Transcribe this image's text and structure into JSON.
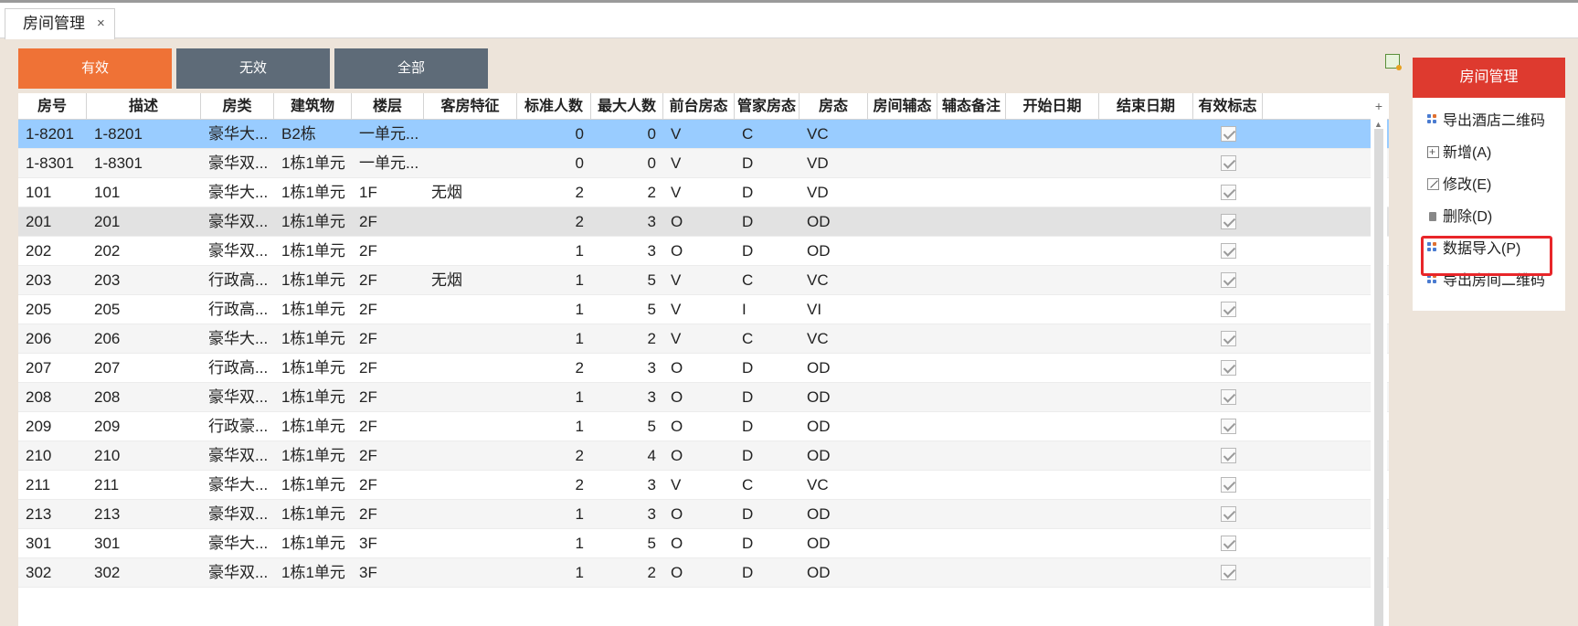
{
  "tab": {
    "label": "房间管理",
    "close": "×"
  },
  "filters": {
    "valid": "有效",
    "invalid": "无效",
    "all": "全部"
  },
  "columns": [
    "房号",
    "描述",
    "房类",
    "建筑物",
    "楼层",
    "客房特征",
    "标准人数",
    "最大人数",
    "前台房态",
    "管家房态",
    "房态",
    "房间辅态",
    "辅态备注",
    "开始日期",
    "结束日期",
    "有效标志"
  ],
  "rows": [
    {
      "no": "1-8201",
      "desc": "1-8201",
      "type": "豪华大...",
      "bldg": "B2栋",
      "floor": "一单元...",
      "feat": "",
      "std": "0",
      "max": "0",
      "fd": "V",
      "hk": "C",
      "st": "VC",
      "valid": true
    },
    {
      "no": "1-8301",
      "desc": "1-8301",
      "type": "豪华双...",
      "bldg": "1栋1单元",
      "floor": "一单元...",
      "feat": "",
      "std": "0",
      "max": "0",
      "fd": "V",
      "hk": "D",
      "st": "VD",
      "valid": true
    },
    {
      "no": "101",
      "desc": "101",
      "type": "豪华大...",
      "bldg": "1栋1单元",
      "floor": "1F",
      "feat": "无烟",
      "std": "2",
      "max": "2",
      "fd": "V",
      "hk": "D",
      "st": "VD",
      "valid": true
    },
    {
      "no": "201",
      "desc": "201",
      "type": "豪华双...",
      "bldg": "1栋1单元",
      "floor": "2F",
      "feat": "",
      "std": "2",
      "max": "3",
      "fd": "O",
      "hk": "D",
      "st": "OD",
      "valid": true
    },
    {
      "no": "202",
      "desc": "202",
      "type": "豪华双...",
      "bldg": "1栋1单元",
      "floor": "2F",
      "feat": "",
      "std": "1",
      "max": "3",
      "fd": "O",
      "hk": "D",
      "st": "OD",
      "valid": true
    },
    {
      "no": "203",
      "desc": "203",
      "type": "行政高...",
      "bldg": "1栋1单元",
      "floor": "2F",
      "feat": "无烟",
      "std": "1",
      "max": "5",
      "fd": "V",
      "hk": "C",
      "st": "VC",
      "valid": true
    },
    {
      "no": "205",
      "desc": "205",
      "type": "行政高...",
      "bldg": "1栋1单元",
      "floor": "2F",
      "feat": "",
      "std": "1",
      "max": "5",
      "fd": "V",
      "hk": "I",
      "st": "VI",
      "valid": true
    },
    {
      "no": "206",
      "desc": "206",
      "type": "豪华大...",
      "bldg": "1栋1单元",
      "floor": "2F",
      "feat": "",
      "std": "1",
      "max": "2",
      "fd": "V",
      "hk": "C",
      "st": "VC",
      "valid": true
    },
    {
      "no": "207",
      "desc": "207",
      "type": "行政高...",
      "bldg": "1栋1单元",
      "floor": "2F",
      "feat": "",
      "std": "2",
      "max": "3",
      "fd": "O",
      "hk": "D",
      "st": "OD",
      "valid": true
    },
    {
      "no": "208",
      "desc": "208",
      "type": "豪华双...",
      "bldg": "1栋1单元",
      "floor": "2F",
      "feat": "",
      "std": "1",
      "max": "3",
      "fd": "O",
      "hk": "D",
      "st": "OD",
      "valid": true
    },
    {
      "no": "209",
      "desc": "209",
      "type": "行政豪...",
      "bldg": "1栋1单元",
      "floor": "2F",
      "feat": "",
      "std": "1",
      "max": "5",
      "fd": "O",
      "hk": "D",
      "st": "OD",
      "valid": true
    },
    {
      "no": "210",
      "desc": "210",
      "type": "豪华双...",
      "bldg": "1栋1单元",
      "floor": "2F",
      "feat": "",
      "std": "2",
      "max": "4",
      "fd": "O",
      "hk": "D",
      "st": "OD",
      "valid": true
    },
    {
      "no": "211",
      "desc": "211",
      "type": "豪华大...",
      "bldg": "1栋1单元",
      "floor": "2F",
      "feat": "",
      "std": "2",
      "max": "3",
      "fd": "V",
      "hk": "C",
      "st": "VC",
      "valid": true
    },
    {
      "no": "213",
      "desc": "213",
      "type": "豪华双...",
      "bldg": "1栋1单元",
      "floor": "2F",
      "feat": "",
      "std": "1",
      "max": "3",
      "fd": "O",
      "hk": "D",
      "st": "OD",
      "valid": true
    },
    {
      "no": "301",
      "desc": "301",
      "type": "豪华大...",
      "bldg": "1栋1单元",
      "floor": "3F",
      "feat": "",
      "std": "1",
      "max": "5",
      "fd": "O",
      "hk": "D",
      "st": "OD",
      "valid": true
    },
    {
      "no": "302",
      "desc": "302",
      "type": "豪华双...",
      "bldg": "1栋1单元",
      "floor": "3F",
      "feat": "",
      "std": "1",
      "max": "2",
      "fd": "O",
      "hk": "D",
      "st": "OD",
      "valid": true
    }
  ],
  "selected_row": 0,
  "hover_row": 3,
  "panel": {
    "title": "房间管理",
    "items": [
      {
        "label": "导出酒店二维码",
        "icon": "qr-icon"
      },
      {
        "label": "新增(A)",
        "icon": "plus-icon"
      },
      {
        "label": "修改(E)",
        "icon": "edit-icon"
      },
      {
        "label": "删除(D)",
        "icon": "trash-icon"
      },
      {
        "label": "数据导入(P)",
        "icon": "import-icon"
      },
      {
        "label": "导出房间二维码",
        "icon": "qr-icon"
      }
    ],
    "highlighted_item": 4
  },
  "colors": {
    "accent": "#ef7236",
    "header_red": "#de3a2f",
    "selected": "#99ccff",
    "button_gray": "#5e6b78",
    "highlight_border": "#e8262a"
  }
}
